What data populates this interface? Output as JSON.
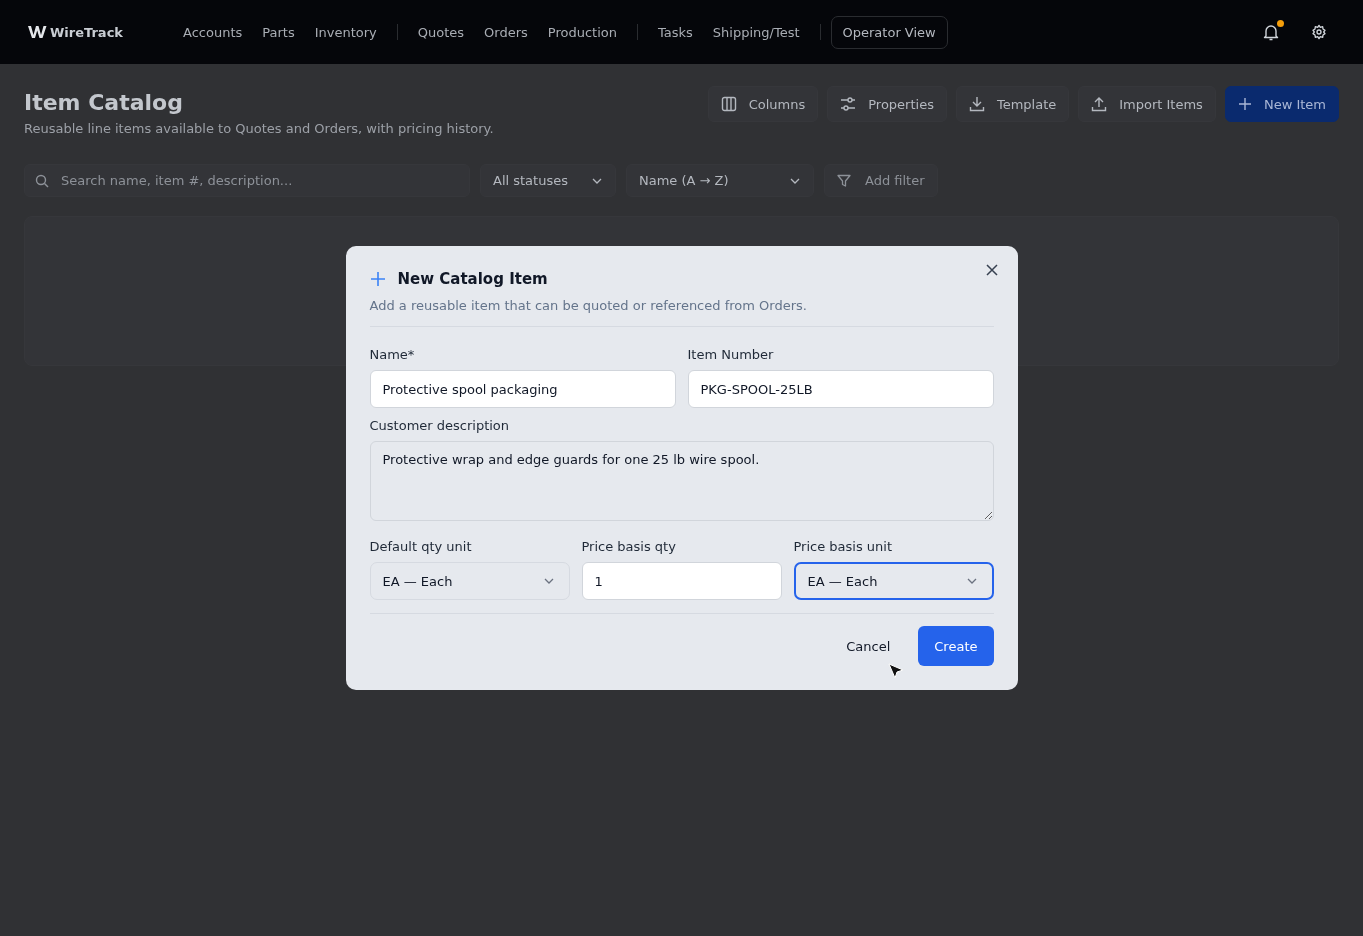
{
  "app": {
    "brand": "WireTrack",
    "nav_groups": [
      [
        "Accounts",
        "Parts",
        "Inventory"
      ],
      [
        "Quotes",
        "Orders",
        "Production"
      ],
      [
        "Tasks",
        "Shipping/Test"
      ]
    ],
    "operator_button": "Operator View",
    "notifications_unread": true
  },
  "page": {
    "title": "Item Catalog",
    "subtitle": "Reusable line items available to Quotes and Orders, with pricing history.",
    "actions": [
      {
        "label": "Columns",
        "kind": "columns",
        "primary": false
      },
      {
        "label": "Properties",
        "kind": "sliders",
        "primary": false
      },
      {
        "label": "Template",
        "kind": "download",
        "primary": false
      },
      {
        "label": "Import Items",
        "kind": "upload",
        "primary": false
      },
      {
        "label": "New Item",
        "kind": "plus",
        "primary": true
      }
    ],
    "search": {
      "placeholder": "Search name, item #, description..."
    },
    "status_filter": "All statuses",
    "sort": "Name (A → Z)",
    "add_filter": "Add filter"
  },
  "dialog": {
    "title": "New Catalog Item",
    "subtitle": "Add a reusable item that can be quoted or referenced from Orders.",
    "name": {
      "label": "Name*",
      "value": "Protective spool packaging"
    },
    "item_number": {
      "label": "Item Number",
      "value": "PKG-SPOOL-25LB"
    },
    "description": {
      "label": "Customer description",
      "value": "Protective wrap and edge guards for one 25 lb wire spool."
    },
    "unit_fields": [
      {
        "kind": "select",
        "label": "Default qty unit",
        "value": "EA — Each",
        "focused": false
      },
      {
        "kind": "input",
        "label": "Price basis qty",
        "value": "1",
        "focused": false
      },
      {
        "kind": "select",
        "label": "Price basis unit",
        "value": "EA — Each",
        "focused": true
      }
    ],
    "cancel": "Cancel",
    "create": "Create"
  }
}
